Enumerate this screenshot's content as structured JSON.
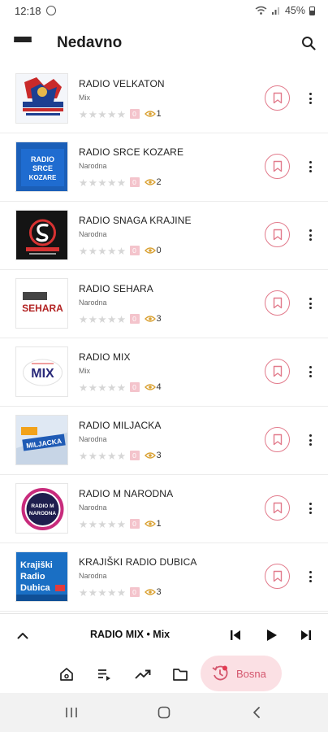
{
  "status_bar": {
    "time": "12:18",
    "battery": "45%"
  },
  "app_bar": {
    "title": "Nedavno"
  },
  "stations": [
    {
      "name": "RADIO VELKATON",
      "genre": "Mix",
      "views": "1",
      "badge": "0",
      "logo": "velkaton"
    },
    {
      "name": "RADIO SRCE KOZARE",
      "genre": "Narodna",
      "views": "2",
      "badge": "0",
      "logo": "srce",
      "logo_text": [
        "RADIO",
        "SRCE",
        "KOZARE"
      ]
    },
    {
      "name": "RADIO SNAGA KRAJINE",
      "genre": "Narodna",
      "views": "0",
      "badge": "0",
      "logo": "snaga"
    },
    {
      "name": "RADIO SEHARA",
      "genre": "Narodna",
      "views": "3",
      "badge": "0",
      "logo": "sehara",
      "logo_text": [
        "SEHARA"
      ]
    },
    {
      "name": "RADIO MIX",
      "genre": "Mix",
      "views": "4",
      "badge": "0",
      "logo": "mix",
      "logo_text": [
        "MIX"
      ]
    },
    {
      "name": "RADIO MILJACKA",
      "genre": "Narodna",
      "views": "3",
      "badge": "0",
      "logo": "miljacka",
      "logo_text": [
        "MILJACKA"
      ]
    },
    {
      "name": "RADIO M NARODNA",
      "genre": "Narodna",
      "views": "1",
      "badge": "0",
      "logo": "mnarodna",
      "logo_text": [
        "RADIO M",
        "NARODNA"
      ]
    },
    {
      "name": "KRAJIŠKI RADIO DUBICA",
      "genre": "Narodna",
      "views": "3",
      "badge": "0",
      "logo": "dubica",
      "logo_text": [
        "Krajiški",
        "Radio",
        "Dubica"
      ]
    }
  ],
  "player": {
    "now_playing": "RADIO MIX • Mix"
  },
  "bottom_nav": {
    "active_label": "Bosna"
  },
  "colors": {
    "accent": "#d4566d",
    "accent_light": "#fbe0e4",
    "fav_border": "#e27a8b",
    "star": "#d6d6d6"
  }
}
